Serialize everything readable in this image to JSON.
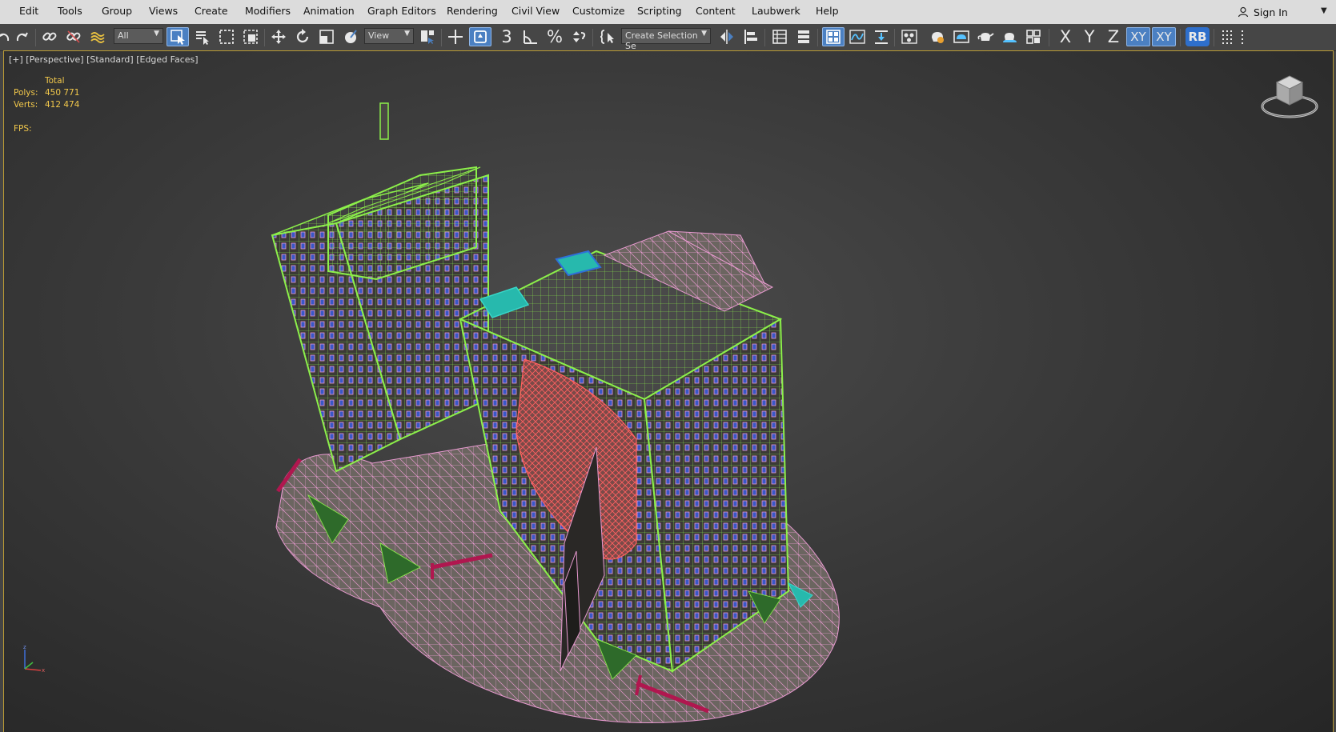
{
  "menu": {
    "items": [
      "Edit",
      "Tools",
      "Group",
      "Views",
      "Create",
      "Modifiers",
      "Animation",
      "Graph Editors",
      "Rendering",
      "Civil View",
      "Customize",
      "Scripting",
      "Content",
      "Laubwerk",
      "Help"
    ],
    "sign_in": "Sign In"
  },
  "toolbar": {
    "filter_dropdown": "All",
    "coord_dropdown": "View",
    "selection_set": "Create Selection Se",
    "axis_labels": [
      "X",
      "Y",
      "Z",
      "XY",
      "XY"
    ],
    "rb_label": "RB"
  },
  "viewport": {
    "label": "[+] [Perspective] [Standard] [Edged Faces]",
    "stats": {
      "total_label": "Total",
      "polys_label": "Polys:",
      "polys_value": "450 771",
      "verts_label": "Verts:",
      "verts_value": "412 474",
      "fps_label": "FPS:"
    }
  },
  "colors": {
    "accent": "#4b80c2",
    "stats_text": "#f2c84b",
    "wire_green": "#8cf04a",
    "wire_pink": "#e89ad0",
    "wire_red": "#ff6060",
    "wire_cyan": "#37d6c8"
  }
}
